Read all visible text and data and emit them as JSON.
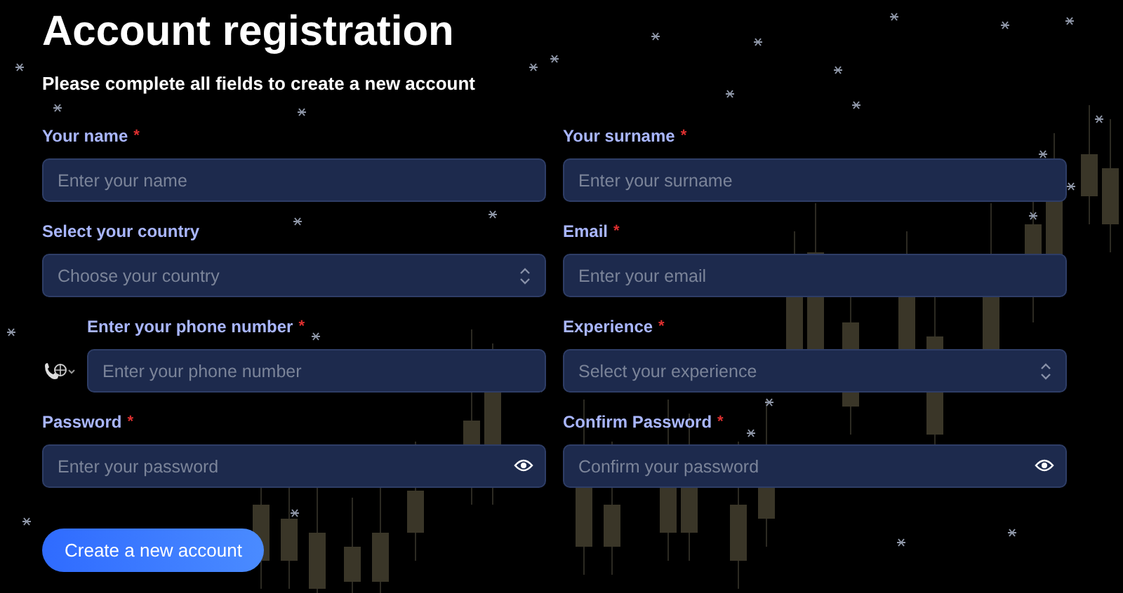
{
  "title": "Account registration",
  "subtitle": "Please complete all fields to create a new account",
  "fields": [
    {
      "kind": "text",
      "label": "Your name",
      "required_mark": "*",
      "placeholder": "Enter your name"
    },
    {
      "kind": "text",
      "label": "Your surname",
      "required_mark": "*",
      "placeholder": "Enter your surname"
    },
    {
      "kind": "select",
      "label": "Select your country",
      "placeholder": "Choose your country"
    },
    {
      "kind": "text",
      "label": "Email",
      "required_mark": "*",
      "placeholder": "Enter your email"
    },
    {
      "kind": "phone",
      "label": "Enter your phone number",
      "required_mark": "*",
      "placeholder": "Enter your phone number"
    },
    {
      "kind": "select",
      "label": "Experience",
      "required_mark": "*",
      "placeholder": "Select your experience"
    },
    {
      "kind": "password",
      "label": "Password",
      "required_mark": "*",
      "placeholder": "Enter your password"
    },
    {
      "kind": "password",
      "label": "Confirm Password",
      "required_mark": "*",
      "placeholder": "Confirm your password"
    }
  ],
  "submit": "Create a new account"
}
